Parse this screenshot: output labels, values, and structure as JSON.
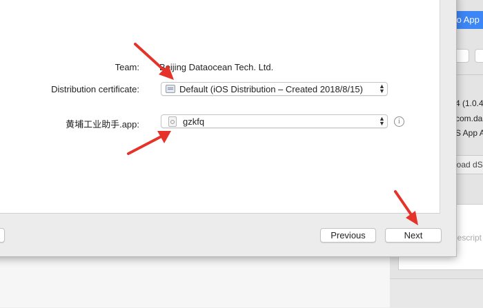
{
  "background": {
    "upload_button_label": "to App",
    "info_lines": [
      "4 (1.0.4",
      "com.da",
      "S App A"
    ],
    "load_label": "load dS",
    "description_placeholder": "Descript"
  },
  "sheet": {
    "team_label": "Team:",
    "team_value": "Beijing Dataocean Tech. Ltd.",
    "certificate_label": "Distribution certificate:",
    "certificate_value": "Default (iOS Distribution – Created 2018/8/15)",
    "profile_label": "黄埔工业助手.app:",
    "profile_value": "gzkfq",
    "info_icon": "i",
    "previous_label": "Previous",
    "next_label": "Next"
  },
  "colors": {
    "annotation_arrow": "#e5332a",
    "accent": "#3d86f5"
  }
}
